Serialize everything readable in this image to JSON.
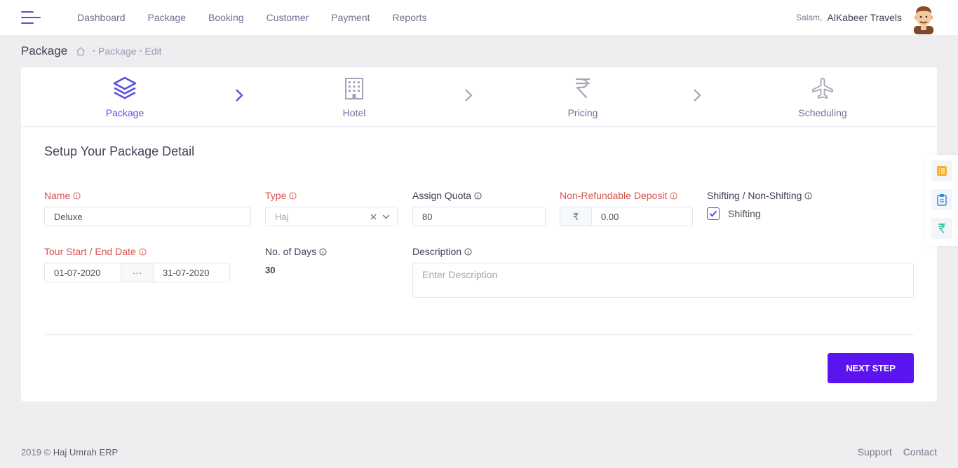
{
  "header": {
    "nav": [
      "Dashboard",
      "Package",
      "Booking",
      "Customer",
      "Payment",
      "Reports"
    ],
    "greeting": "Salam,",
    "user_name": "AlKabeer Travels"
  },
  "subheader": {
    "title": "Package",
    "breadcrumb": [
      "Package",
      "Edit"
    ]
  },
  "wizard": {
    "steps": [
      {
        "label": "Package",
        "icon": "layers-icon",
        "active": true
      },
      {
        "label": "Hotel",
        "icon": "building-icon",
        "active": false
      },
      {
        "label": "Pricing",
        "icon": "rupee-icon",
        "active": false
      },
      {
        "label": "Scheduling",
        "icon": "airplane-icon",
        "active": false
      }
    ]
  },
  "form": {
    "title": "Setup Your Package Detail",
    "name": {
      "label": "Name",
      "value": "Deluxe"
    },
    "type": {
      "label": "Type",
      "value": "Haj"
    },
    "quota": {
      "label": "Assign Quota",
      "value": "80"
    },
    "deposit": {
      "label": "Non-Refundable Deposit",
      "currency": "₹",
      "value": "0.00"
    },
    "shifting": {
      "label": "Shifting / Non-Shifting",
      "option": "Shifting",
      "checked": true
    },
    "dates": {
      "label": "Tour Start / End Date",
      "start": "01-07-2020",
      "separator": "···",
      "end": "31-07-2020"
    },
    "days": {
      "label": "No. of Days",
      "value": "30"
    },
    "description": {
      "label": "Description",
      "placeholder": "Enter Description"
    }
  },
  "actions": {
    "next": "NEXT STEP"
  },
  "footer": {
    "year": "2019 ©",
    "brand": "Haj Umrah ERP",
    "links": [
      "Support",
      "Contact"
    ]
  },
  "colors": {
    "accent": "#5b4fe0",
    "button": "#5b14f0",
    "required": "#d9534f"
  }
}
